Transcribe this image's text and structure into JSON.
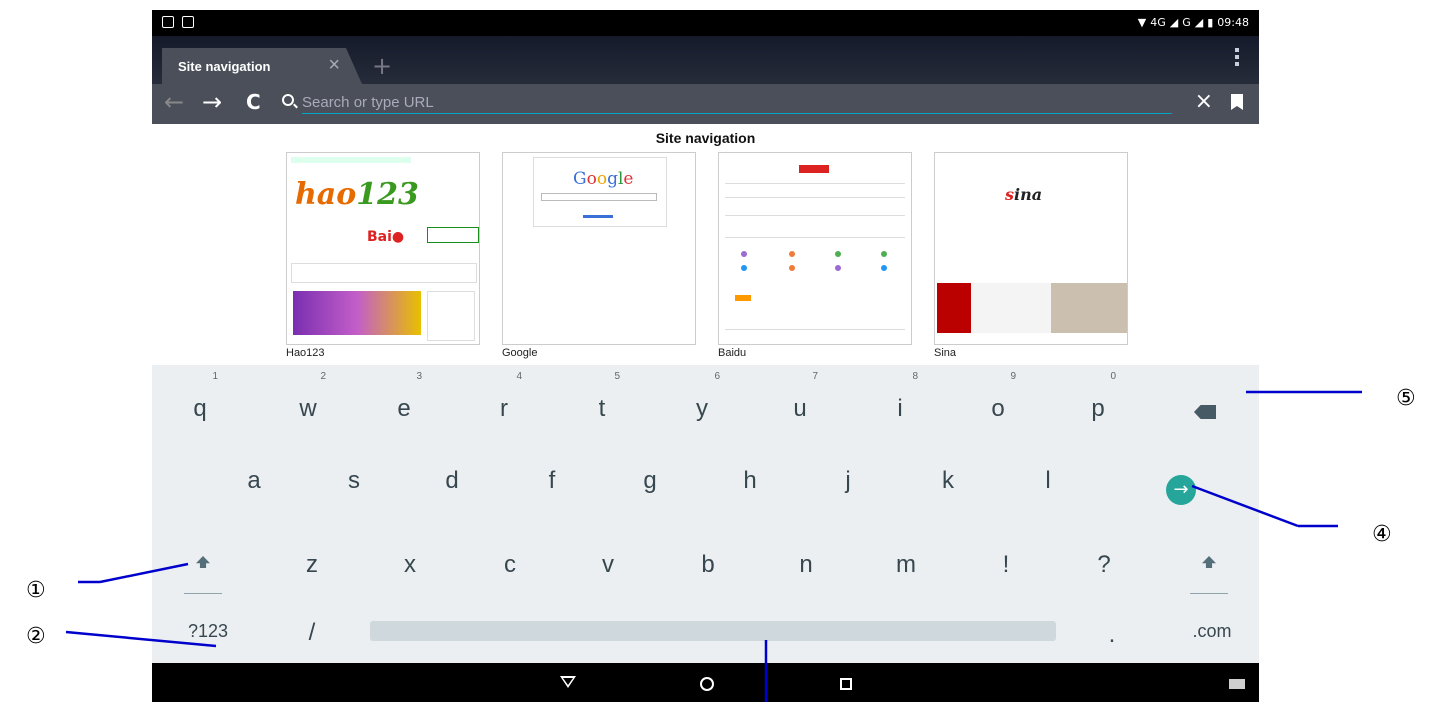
{
  "status_bar": {
    "network": "4G",
    "signal_text": "G",
    "time": "09:48"
  },
  "tab": {
    "title": "Site navigation",
    "close_glyph": "×",
    "new_tab_glyph": "+"
  },
  "url_bar": {
    "placeholder": "Search or type URL",
    "value": "",
    "clear_glyph": "×"
  },
  "site_navigation": {
    "title": "Site navigation",
    "thumbnails": [
      {
        "label": "Hao123"
      },
      {
        "label": "Google"
      },
      {
        "label": "Baidu"
      },
      {
        "label": "Sina"
      }
    ]
  },
  "keyboard": {
    "row1": [
      {
        "key": "q",
        "hint": "1"
      },
      {
        "key": "w",
        "hint": "2"
      },
      {
        "key": "e",
        "hint": "3"
      },
      {
        "key": "r",
        "hint": "4"
      },
      {
        "key": "t",
        "hint": "5"
      },
      {
        "key": "y",
        "hint": "6"
      },
      {
        "key": "u",
        "hint": "7"
      },
      {
        "key": "i",
        "hint": "8"
      },
      {
        "key": "o",
        "hint": "9"
      },
      {
        "key": "p",
        "hint": "0"
      }
    ],
    "row2": [
      "a",
      "s",
      "d",
      "f",
      "g",
      "h",
      "j",
      "k",
      "l"
    ],
    "row3": [
      "z",
      "x",
      "c",
      "v",
      "b",
      "n",
      "m",
      "!",
      "?"
    ],
    "symbols_key": "?123",
    "slash_key": "/",
    "period_key": ".",
    "dotcom_key": ".com",
    "go_glyph": "→"
  },
  "callouts": [
    "①",
    "②",
    "④",
    "⑤"
  ],
  "colors": {
    "accent_teal": "#26a69a",
    "url_underline": "#00a5c8",
    "callout_line": "#0000cc"
  }
}
